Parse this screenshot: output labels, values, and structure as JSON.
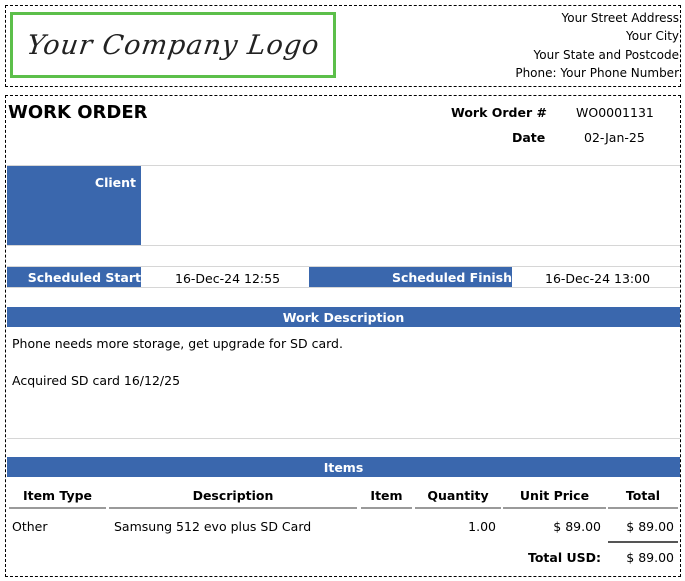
{
  "logo": {
    "text": "Your Company Logo",
    "border_color": "#5cbf4a"
  },
  "company_address": {
    "street": "Your Street Address",
    "city": "Your City",
    "state_postcode": "Your State and Postcode",
    "phone": "Phone: Your Phone Number"
  },
  "header": {
    "title": "WORK ORDER",
    "work_order_label": "Work Order #",
    "work_order_value": "WO0001131",
    "date_label": "Date",
    "date_value": "02-Jan-25"
  },
  "client": {
    "label": "Client",
    "value": ""
  },
  "schedule": {
    "start_label": "Scheduled Start",
    "start_value": "16-Dec-24 12:55",
    "finish_label": "Scheduled Finish",
    "finish_value": "16-Dec-24 13:00"
  },
  "work_description": {
    "heading": "Work Description",
    "lines": [
      "Phone needs more storage, get upgrade for SD card.",
      "Acquired SD card 16/12/25"
    ]
  },
  "items": {
    "heading": "Items",
    "columns": [
      "Item Type",
      "Description",
      "Item",
      "Quantity",
      "Unit Price",
      "Total"
    ],
    "rows": [
      {
        "item_type": "Other",
        "description": "Samsung 512 evo plus SD Card",
        "item": "",
        "quantity": "1.00",
        "unit_price": "$ 89.00",
        "total": "$ 89.00"
      }
    ],
    "total_label": "Total USD:",
    "total_value": "$ 89.00"
  },
  "colors": {
    "accent": "#3a67ad"
  }
}
